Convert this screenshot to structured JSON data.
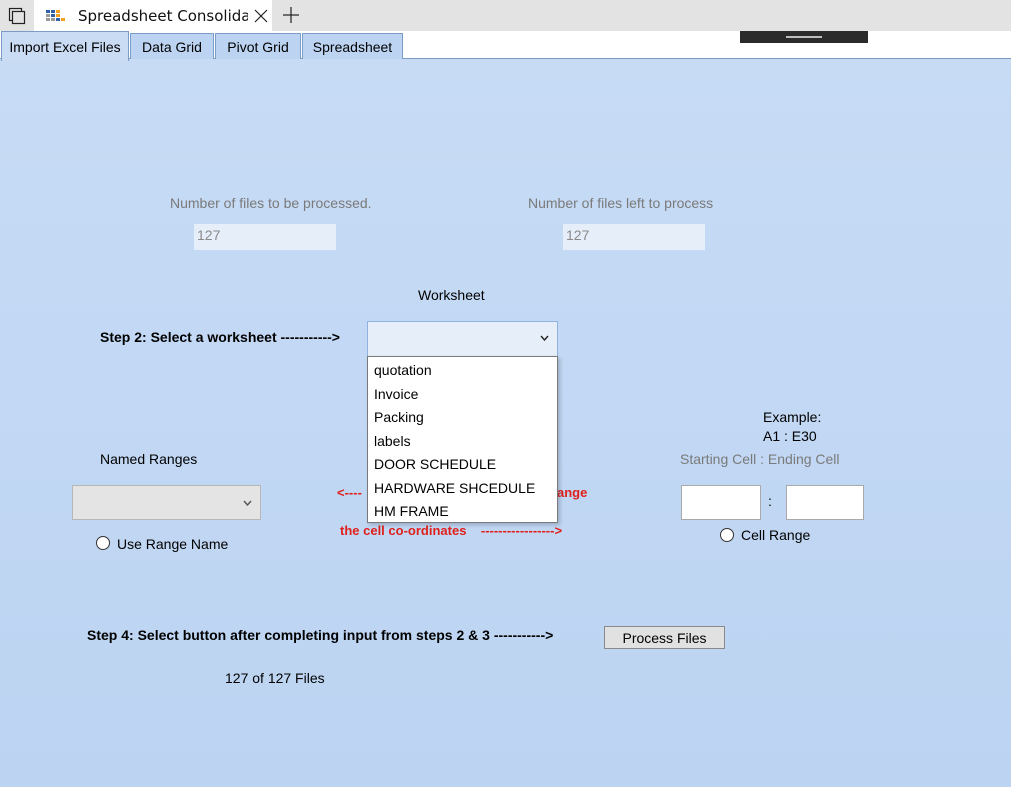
{
  "window": {
    "title": "Spreadsheet Consolida"
  },
  "tabs": [
    {
      "label": "Import Excel Files",
      "active": true
    },
    {
      "label": "Data Grid",
      "active": false
    },
    {
      "label": "Pivot Grid",
      "active": false
    },
    {
      "label": "Spreadsheet",
      "active": false
    }
  ],
  "files": {
    "to_process_label": "Number of files to be processed.",
    "to_process_value": "127",
    "left_label": "Number of files left to process",
    "left_value": "127"
  },
  "worksheet": {
    "label": "Worksheet",
    "step_label": "Step 2: Select a worksheet ----------->",
    "selected": "",
    "options": [
      "quotation",
      "Invoice",
      "Packing",
      "labels",
      "DOOR SCHEDULE",
      "HARDWARE SHCEDULE",
      "HM FRAME"
    ]
  },
  "named_ranges": {
    "label": "Named Ranges",
    "selected": "",
    "use_range_label": "Use Range Name"
  },
  "step3": {
    "line1_left": "<----",
    "line1_right": "ange",
    "line2": "the cell co-ordinates    ----------------->"
  },
  "cell_range": {
    "example_label": "Example:",
    "example_value": "A1 : E30",
    "hint": "Starting Cell : Ending Cell",
    "separator": ":",
    "start_value": "",
    "end_value": "",
    "radio_label": "Cell Range"
  },
  "step4": {
    "label": "Step 4: Select button after completing input from steps 2 & 3 ----------->",
    "button_label": "Process Files",
    "status": "127 of 127 Files"
  },
  "colors": {
    "background": "#c9dcf4",
    "accent_red": "#e0201b",
    "tab_border": "#7a9cc6"
  }
}
